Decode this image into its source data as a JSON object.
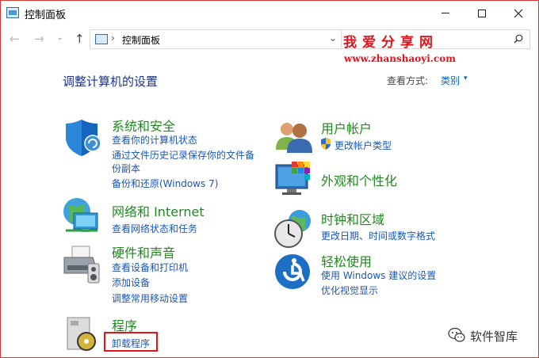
{
  "window": {
    "title": "控制面板",
    "minimize": "—",
    "maximize": "☐",
    "close": "✕"
  },
  "nav": {
    "back": "←",
    "forward": "→",
    "recent": "⌄",
    "up": "↑",
    "address_path": "控制面板",
    "address_sep": "›",
    "address_dropdown": "⌄"
  },
  "watermark": {
    "title": "我爱分享网",
    "url": "www.zhanshaoyi.com",
    "footer": "软件智库"
  },
  "header": {
    "title": "调整计算机的设置",
    "view_label": "查看方式:",
    "view_value": "类别",
    "view_dropdown": "▾"
  },
  "categories": {
    "system": {
      "title": "系统和安全",
      "links": [
        "查看你的计算机状态",
        "通过文件历史记录保存你的文件备",
        "份副本",
        "备份和还原(Windows 7)"
      ]
    },
    "network": {
      "title": "网络和 Internet",
      "links": [
        "查看网络状态和任务"
      ]
    },
    "hardware": {
      "title": "硬件和声音",
      "links": [
        "查看设备和打印机",
        "添加设备",
        "调整常用移动设置"
      ]
    },
    "programs": {
      "title": "程序",
      "links": [
        "卸载程序"
      ]
    },
    "accounts": {
      "title": "用户帐户",
      "links": [
        "更改帐户类型"
      ]
    },
    "appearance": {
      "title": "外观和个性化",
      "links": []
    },
    "clock": {
      "title": "时钟和区域",
      "links": [
        "更改日期、时间或数字格式"
      ]
    },
    "ease": {
      "title": "轻松使用",
      "links": [
        "使用 Windows 建议的设置",
        "优化视觉显示"
      ]
    }
  },
  "colors": {
    "category_title": "#1f8a1f",
    "link": "#1a57b4",
    "page_title": "#1e3287",
    "highlight": "#e0151b"
  }
}
